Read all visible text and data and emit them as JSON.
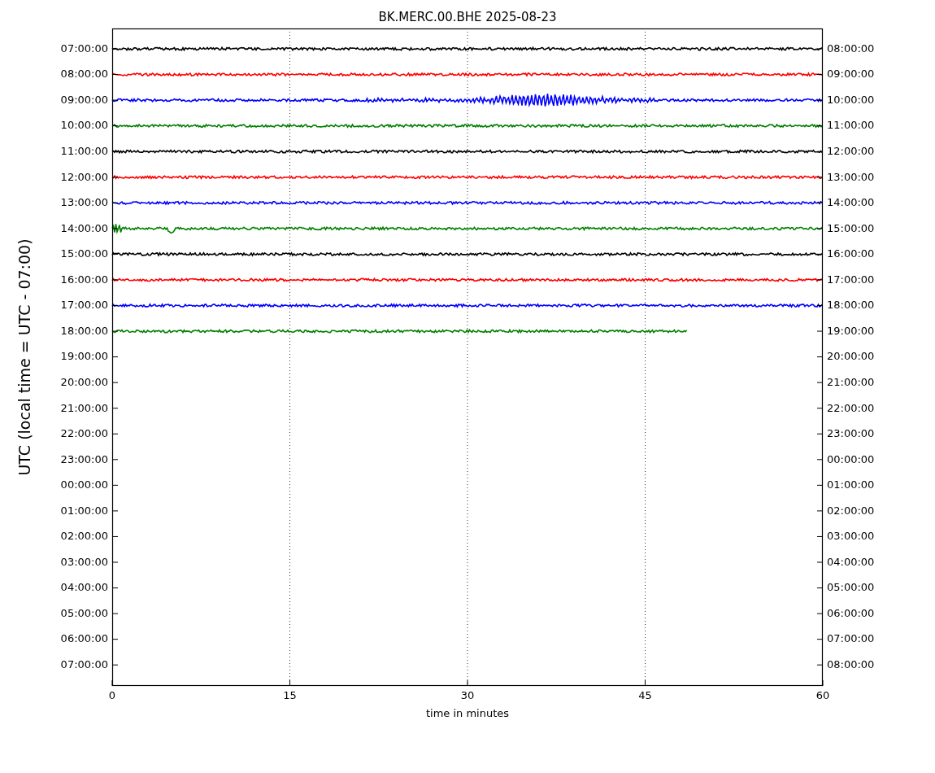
{
  "title": "BK.MERC.00.BHE 2025-08-23",
  "ylabel": "UTC (local time = UTC - 07:00)",
  "xlabel": "time in minutes",
  "xticks": [
    "0",
    "15",
    "30",
    "45",
    "60"
  ],
  "left_ticks": [
    "07:00:00",
    "08:00:00",
    "09:00:00",
    "10:00:00",
    "11:00:00",
    "12:00:00",
    "13:00:00",
    "14:00:00",
    "15:00:00",
    "16:00:00",
    "17:00:00",
    "18:00:00",
    "19:00:00",
    "20:00:00",
    "21:00:00",
    "22:00:00",
    "23:00:00",
    "00:00:00",
    "01:00:00",
    "02:00:00",
    "03:00:00",
    "04:00:00",
    "05:00:00",
    "06:00:00",
    "07:00:00"
  ],
  "right_ticks": [
    "08:00:00",
    "09:00:00",
    "10:00:00",
    "11:00:00",
    "12:00:00",
    "13:00:00",
    "14:00:00",
    "15:00:00",
    "16:00:00",
    "17:00:00",
    "18:00:00",
    "19:00:00",
    "20:00:00",
    "21:00:00",
    "22:00:00",
    "23:00:00",
    "00:00:00",
    "01:00:00",
    "02:00:00",
    "03:00:00",
    "04:00:00",
    "05:00:00",
    "06:00:00",
    "07:00:00",
    "08:00:00"
  ],
  "traces": [
    {
      "color": "#000000",
      "level": 1,
      "kind": "noise"
    },
    {
      "color": "#ff0000",
      "level": 1,
      "kind": "noise"
    },
    {
      "color": "#0000ff",
      "level": 1,
      "kind": "quake"
    },
    {
      "color": "#008000",
      "level": 1,
      "kind": "noise"
    },
    {
      "color": "#000000",
      "level": 1,
      "kind": "noise"
    },
    {
      "color": "#ff0000",
      "level": 1,
      "kind": "noise"
    },
    {
      "color": "#0000ff",
      "level": 1,
      "kind": "noise"
    },
    {
      "color": "#008000",
      "level": 1,
      "kind": "spike"
    },
    {
      "color": "#000000",
      "level": 1,
      "kind": "noise"
    },
    {
      "color": "#ff0000",
      "level": 1,
      "kind": "noise"
    },
    {
      "color": "#0000ff",
      "level": 1,
      "kind": "noise"
    },
    {
      "color": "#008000",
      "level": 0.81,
      "kind": "noise"
    }
  ]
}
